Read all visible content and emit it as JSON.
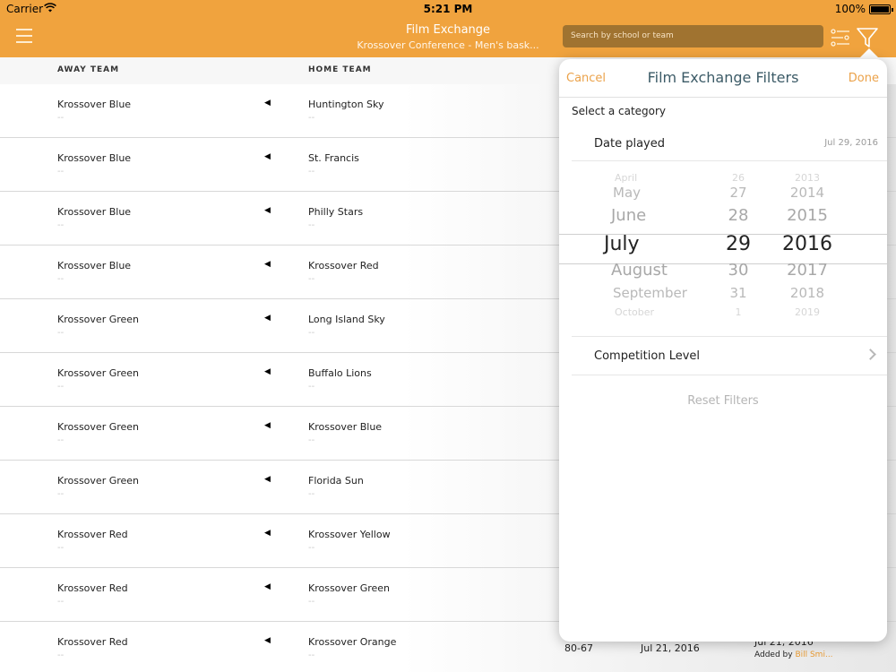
{
  "status_bar": {
    "carrier": "Carrier",
    "time": "5:21 PM",
    "battery": "100%"
  },
  "nav": {
    "title": "Film Exchange",
    "subtitle": "Krossover Conference - Men's bask...",
    "search_placeholder": "Search by school or team"
  },
  "table": {
    "headers": {
      "away": "AWAY TEAM",
      "home": "HOME TEAM"
    },
    "rows": [
      {
        "away": "Krossover Blue",
        "away_sub": "--",
        "home": "Huntington Sky",
        "home_sub": "--"
      },
      {
        "away": "Krossover Blue",
        "away_sub": "--",
        "home": "St. Francis",
        "home_sub": "--"
      },
      {
        "away": "Krossover Blue",
        "away_sub": "--",
        "home": "Philly Stars",
        "home_sub": "--"
      },
      {
        "away": "Krossover Blue",
        "away_sub": "--",
        "home": "Krossover Red",
        "home_sub": "--"
      },
      {
        "away": "Krossover Green",
        "away_sub": "--",
        "home": "Long Island Sky",
        "home_sub": "--"
      },
      {
        "away": "Krossover Green",
        "away_sub": "--",
        "home": "Buffalo Lions",
        "home_sub": "--"
      },
      {
        "away": "Krossover Green",
        "away_sub": "--",
        "home": "Krossover Blue",
        "home_sub": "--"
      },
      {
        "away": "Krossover Green",
        "away_sub": "--",
        "home": "Florida Sun",
        "home_sub": "--"
      },
      {
        "away": "Krossover Red",
        "away_sub": "--",
        "home": "Krossover Yellow",
        "home_sub": "--"
      },
      {
        "away": "Krossover Red",
        "away_sub": "--",
        "home": "Krossover Green",
        "home_sub": "--"
      },
      {
        "away": "Krossover Red",
        "away_sub": "--",
        "home": "Krossover Orange",
        "home_sub": "--",
        "score": "80-67",
        "date": "Jul 21, 2016",
        "added_date": "Jul 21, 2016",
        "added_by_prefix": "Added by ",
        "added_by": "Bill Smi..."
      }
    ]
  },
  "filters": {
    "cancel": "Cancel",
    "title": "Film Exchange Filters",
    "done": "Done",
    "select_category": "Select a category",
    "date_played_label": "Date played",
    "date_played_value": "Jul 29, 2016",
    "picker": {
      "months": [
        "April",
        "May",
        "June",
        "July",
        "August",
        "September",
        "October"
      ],
      "days": [
        "26",
        "27",
        "28",
        "29",
        "30",
        "31",
        "1"
      ],
      "years": [
        "2013",
        "2014",
        "2015",
        "2016",
        "2017",
        "2018",
        "2019"
      ],
      "selected_index": 3
    },
    "competition_level": "Competition Level",
    "reset": "Reset Filters"
  },
  "colors": {
    "accent": "#f0a33e",
    "search_bg": "#a07330",
    "link": "#eba24a",
    "title": "#3c5b67"
  },
  "icons": [
    "menu-icon",
    "wifi-icon",
    "battery-icon",
    "search-icon",
    "filter-list-icon",
    "funnel-icon",
    "play-arrow-icon",
    "chevron-right-icon"
  ]
}
